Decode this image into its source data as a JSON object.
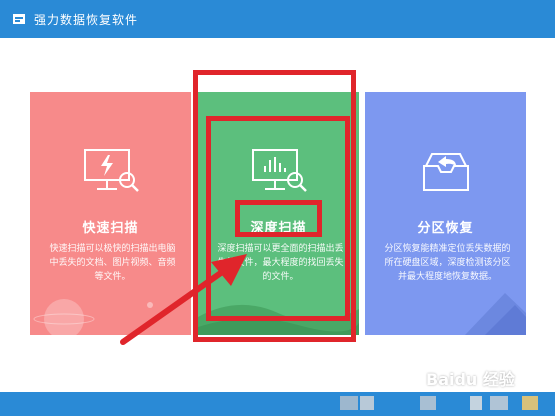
{
  "app": {
    "title": "强力数据恢复软件"
  },
  "cards": [
    {
      "title": "快速扫描",
      "desc": "快速扫描可以极快的扫描出电脑中丢失的文档、图片视频、音频等文件。",
      "icon": "monitor-lightning-icon",
      "color": "#f78a8a"
    },
    {
      "title": "深度扫描",
      "desc": "深度扫描可以更全面的扫描出丢失的文件，最大程度的找回丢失的文件。",
      "icon": "monitor-chart-icon",
      "color": "#5cbf7d"
    },
    {
      "title": "分区恢复",
      "desc": "分区恢复能精准定位丢失数据的所在硬盘区域，深度检测该分区并最大程度地恢复数据。",
      "icon": "inbox-return-icon",
      "color": "#7d98f0"
    }
  ],
  "watermark": "Baidu 经验",
  "colors": {
    "titlebar": "#2a8ad6",
    "highlight": "#e0252b"
  }
}
